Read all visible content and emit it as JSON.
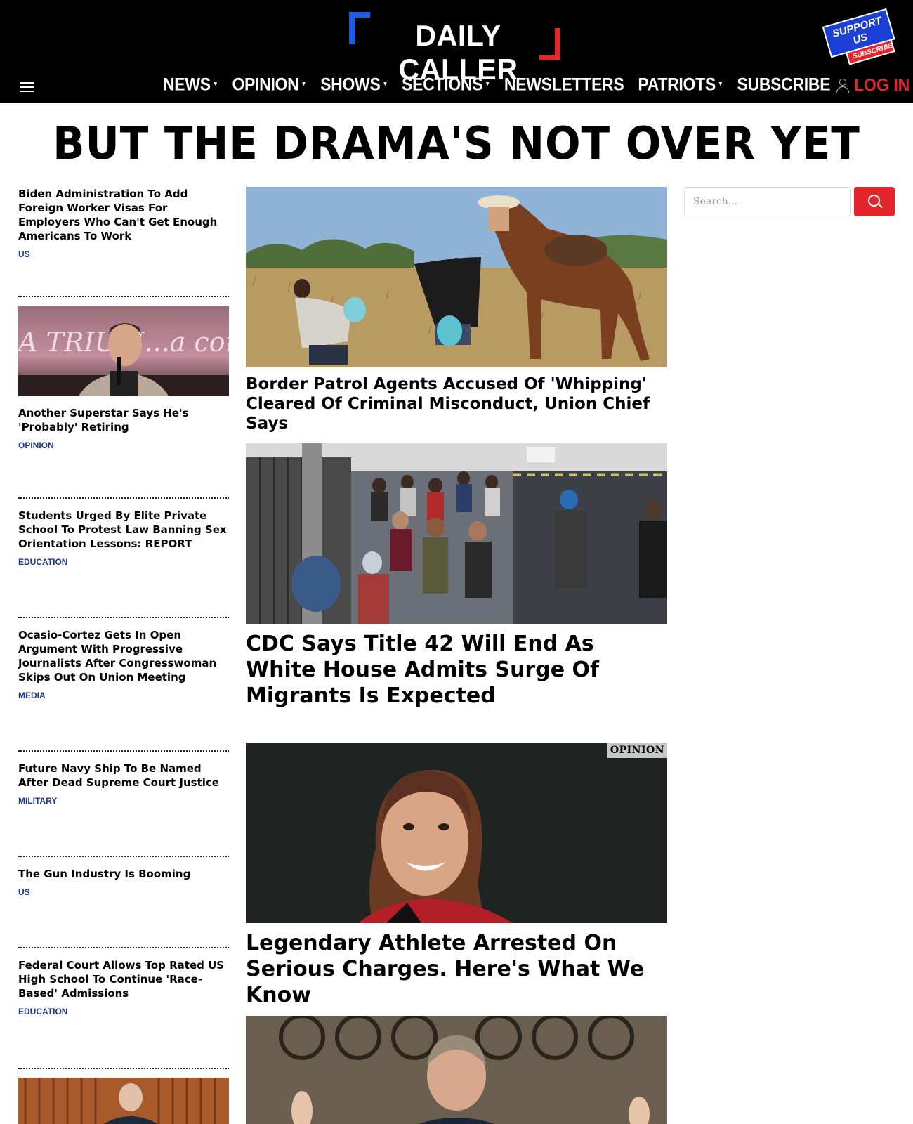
{
  "header": {
    "logo_text": "DAILY CALLER",
    "support_badge": {
      "top": "SUPPORT US",
      "bottom": "SUBSCRIBE"
    },
    "nav": [
      {
        "label": "NEWS",
        "caret": true
      },
      {
        "label": "OPINION",
        "caret": true
      },
      {
        "label": "SHOWS",
        "caret": true
      },
      {
        "label": "SECTIONS",
        "caret": true
      },
      {
        "label": "NEWSLETTERS",
        "caret": false
      },
      {
        "label": "PATRIOTS",
        "caret": true
      },
      {
        "label": "SUBSCRIBE",
        "caret": false
      }
    ],
    "login_label": "LOG IN"
  },
  "banner": "BUT THE DRAMA'S NOT OVER YET",
  "search": {
    "placeholder": "Search..."
  },
  "side_stories": [
    {
      "title": "Biden Administration To Add Foreign Worker Visas For Employers Who Can't Get Enough Americans To Work",
      "category": "US"
    },
    {
      "title": "Another Superstar Says He's 'Probably' Retiring",
      "category": "OPINION",
      "image_text": "A TRIUM...a com"
    },
    {
      "title": "Students Urged By Elite Private School To Protest Law Banning Sex Orientation Lessons: REPORT",
      "category": "EDUCATION"
    },
    {
      "title": "Ocasio-Cortez Gets In Open Argument With Progressive Journalists After Congresswoman Skips Out On Union Meeting",
      "category": "MEDIA"
    },
    {
      "title": "Future Navy Ship To Be Named After Dead Supreme Court Justice",
      "category": "MILITARY"
    },
    {
      "title": "The Gun Industry Is Booming",
      "category": "US"
    },
    {
      "title": "Federal Court Allows Top Rated US High School To Continue 'Race-Based' Admissions",
      "category": "EDUCATION"
    }
  ],
  "main_stories": [
    {
      "title": "Border Patrol Agents Accused Of 'Whipping' Cleared Of Criminal Misconduct, Union Chief Says"
    },
    {
      "title": "CDC Says Title 42 Will End As White House Admits Surge Of Migrants Is Expected"
    },
    {
      "title": "Legendary Athlete Arrested On Serious Charges. Here's What We Know",
      "tag": "OPINION"
    }
  ],
  "colors": {
    "brand_red": "#e4252b",
    "brand_blue": "#1c5be8",
    "category_blue": "#1d3a8a",
    "header_bg": "#000000"
  },
  "icons": [
    "hamburger-icon",
    "user-icon",
    "search-icon"
  ]
}
